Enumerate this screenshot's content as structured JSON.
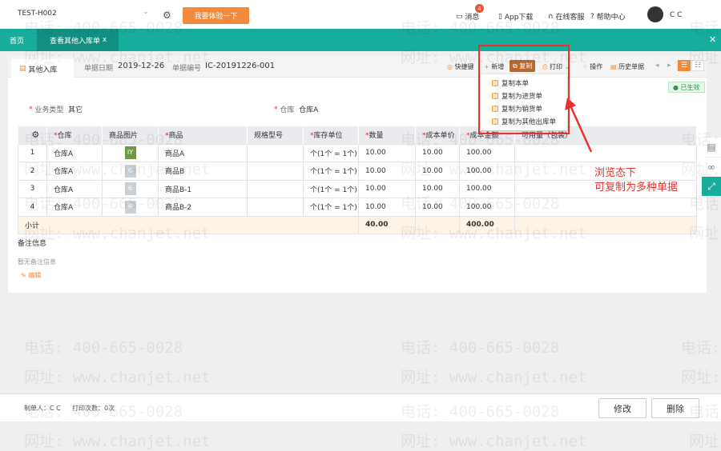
{
  "top": {
    "company": "TEST-H002",
    "try_button": "我要体验一下",
    "messages": "消息",
    "message_badge": "4",
    "app_download": "App下载",
    "online_service": "在线客服",
    "help": "帮助中心",
    "user": "C C"
  },
  "tabs": {
    "home": "首页",
    "active": "查看其他入库单",
    "close": "x",
    "close_all": "✕"
  },
  "doc": {
    "tab": "其他入库",
    "date_label": "单据日期",
    "date": "2019-12-26",
    "no_label": "单据编号",
    "no": "IC-20191226-001",
    "status": "已生效",
    "biz_type_label": "业务类型",
    "biz_type": "其它",
    "warehouse_label": "仓库",
    "warehouse": "仓库A"
  },
  "toolbar": {
    "shortcut": "快捷键",
    "new": "新增",
    "copy": "复制",
    "print": "打印",
    "operate": "操作",
    "history": "历史单据"
  },
  "copy_menu": [
    "复制本单",
    "复制为进货单",
    "复制为销货单",
    "复制为其他出库单"
  ],
  "table": {
    "headers": [
      "仓库",
      "商品图片",
      "商品",
      "规格型号",
      "库存单位",
      "数量",
      "成本单价",
      "成本金额",
      "可用量（包装）"
    ],
    "rows": [
      {
        "n": "1",
        "wh": "仓库A",
        "img": "IY",
        "item": "商品A",
        "unit": "个(1个 = 1个)",
        "qty": "10.00",
        "price": "10.00",
        "amt": "100.00"
      },
      {
        "n": "2",
        "wh": "仓库A",
        "img": "6",
        "item": "商品B",
        "unit": "个(1个 = 1个)",
        "qty": "10.00",
        "price": "10.00",
        "amt": "100.00"
      },
      {
        "n": "3",
        "wh": "仓库A",
        "img": "6",
        "item": "商品B-1",
        "unit": "个(1个 = 1个)",
        "qty": "10.00",
        "price": "10.00",
        "amt": "100.00"
      },
      {
        "n": "4",
        "wh": "仓库A",
        "img": "6",
        "item": "商品B-2",
        "unit": "个(1个 = 1个)",
        "qty": "10.00",
        "price": "10.00",
        "amt": "100.00"
      }
    ],
    "subtotal_label": "小计",
    "subtotal_qty": "40.00",
    "subtotal_amt": "400.00"
  },
  "notes": {
    "title": "备注信息",
    "empty": "暂无备注信息",
    "edit": "编辑"
  },
  "annotation": {
    "line1": "浏览态下",
    "line2": "可复制为多种单据"
  },
  "footer": {
    "maker": "制单人：C C",
    "print_count": "打印次数：0次",
    "edit": "修改",
    "delete": "删除"
  },
  "watermark": {
    "phone": "电话: 400-665-0028",
    "site": "网址: www.chanjet.net"
  }
}
